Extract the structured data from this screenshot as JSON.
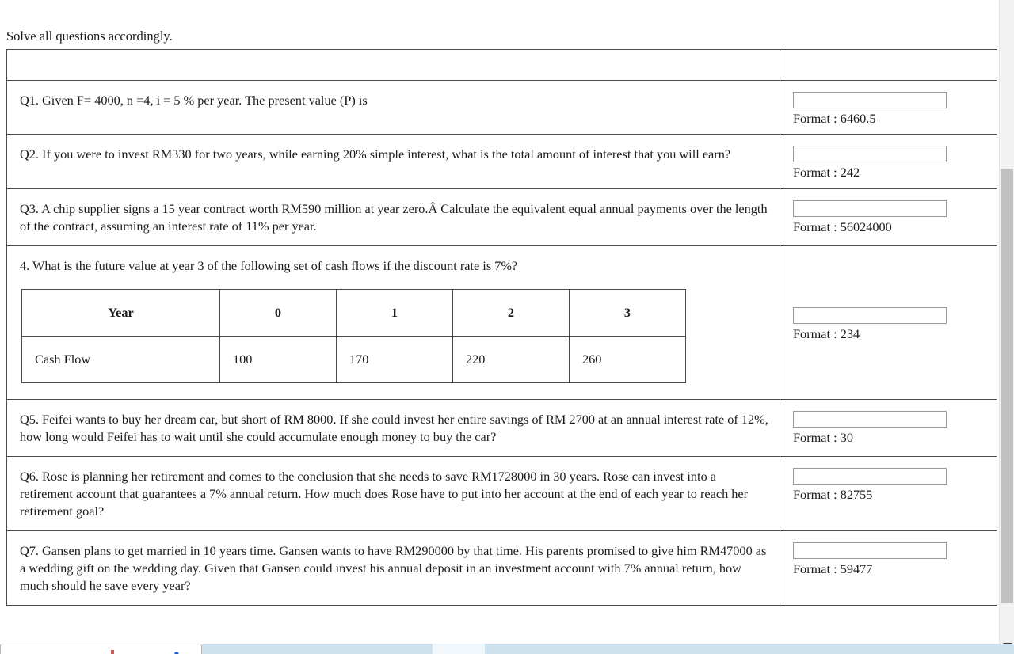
{
  "page": {
    "intro": "Solve all questions accordingly."
  },
  "quiz": {
    "header_row": {
      "question_header": "",
      "answer_header": ""
    },
    "format_prefix": "Format : ",
    "answer_placeholder": "",
    "questions": [
      {
        "id": "q1",
        "text": "Q1. Given F= 4000, n =4, i = 5 % per year. The present value (P) is",
        "answer_value": "",
        "format_label": "Format : 6460.5"
      },
      {
        "id": "q2",
        "text": "Q2. If you were to invest RM330 for two years, while earning 20% simple interest, what is the total amount of interest that you will earn?",
        "answer_value": "",
        "format_label": "Format : 242"
      },
      {
        "id": "q3",
        "text": "Q3. A chip supplier signs a 15 year contract worth RM590 million at year zero.Â Calculate the equivalent equal annual payments over the length of the contract, assuming an interest rate of 11% per year.",
        "answer_value": "",
        "format_label": "Format : 56024000"
      },
      {
        "id": "q4",
        "text": "4. What is the future value at year 3 of the following set of cash flows if the discount rate is 7%?",
        "answer_value": "",
        "format_label": "Format : 234",
        "cash_flow_table": {
          "head": [
            "Year",
            "0",
            "1",
            "2",
            "3"
          ],
          "body": [
            "Cash Flow",
            "100",
            "170",
            "220",
            "260"
          ]
        }
      },
      {
        "id": "q5",
        "text": "Q5. Feifei wants to buy her dream car, but short of RM 8000. If she could invest her entire savings of RM 2700 at an annual interest rate of 12%, how long would Feifei has to wait until she could accumulate enough money to buy the car?",
        "answer_value": "",
        "format_label": "Format : 30"
      },
      {
        "id": "q6",
        "text": "Q6. Rose is planning her retirement and comes to the conclusion that she needs to save RM1728000 in 30 years. Rose can invest into a retirement account that guarantees a 7% annual return. How much does Rose have to put into her account at the end of each year to reach her retirement goal?",
        "answer_value": "",
        "format_label": "Format : 82755"
      },
      {
        "id": "q7",
        "text": "Q7. Gansen plans to get married in 10 years time. Gansen wants to have RM290000 by that time. His parents promised to give him RM47000 as a wedding gift on the wedding day. Given that Gansen could invest his annual deposit in an investment account with 7% annual return, how much should he save every year?",
        "answer_value": "",
        "format_label": "Format : 59477"
      }
    ]
  },
  "chrome": {
    "scrollbar_present": true,
    "bottom_icon": "shield-icon"
  },
  "colors": {
    "page_background": "#ffffff",
    "text": "#1b1b1b",
    "table_border": "#4a4a4a",
    "input_border": "#9a9a9a",
    "scrollbar_track": "#f1f1f1",
    "scrollbar_thumb": "#c1c1c1",
    "taskbar": "#cfe2ef"
  }
}
